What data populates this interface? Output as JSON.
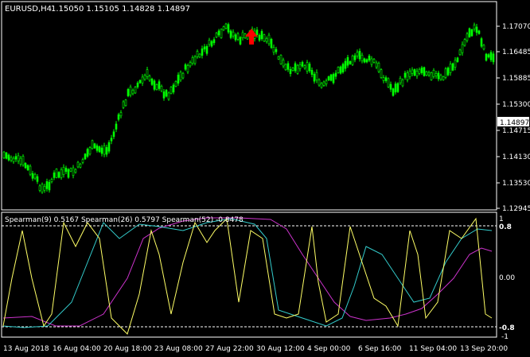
{
  "header": {
    "symbol": "EURUSD,H4",
    "ohlc": "1.15050 1.15105 1.14828 1.14897"
  },
  "price_axis": {
    "labels": [
      "1.17070",
      "1.16485",
      "1.15885",
      "1.15300",
      "1.14715",
      "1.14130",
      "1.13530",
      "1.12945"
    ],
    "current_price": "1.14897"
  },
  "indicator": {
    "legend": "Spearman(9) 0.5167  Spearman(26) 0.5797  Spearman(52) -0.8478",
    "axis_labels": [
      "1",
      "0.8",
      "0.00",
      "-0.8",
      "-1"
    ]
  },
  "time_axis": {
    "labels": [
      "13 Aug 2018",
      "16 Aug 04:00",
      "20 Aug 18:00",
      "23 Aug 08:00",
      "27 Aug 22:00",
      "30 Aug 12:00",
      "4 Sep 00:00",
      "6 Sep 16:00",
      "11 Sep 04:00",
      "13 Sep 20:00"
    ]
  },
  "colors": {
    "background": "#000000",
    "candles": "#00ff00",
    "grid_line": "#ffffff",
    "spearman9": "#ffff66",
    "spearman26": "#33cccc",
    "spearman52": "#cc33cc",
    "arrow": "#ff0000",
    "price_box": "#ffffff"
  },
  "icons": {
    "signal": "red-up-arrow-icon"
  }
}
